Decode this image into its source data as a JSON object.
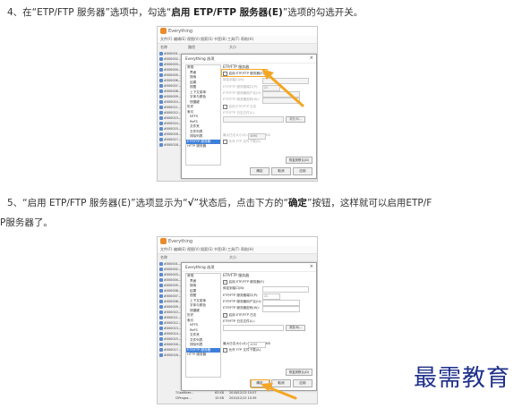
{
  "step4": {
    "pre": "4、在“ETP/FTP 服务器”选项中，勾选“",
    "bold": "启用 ETP/FTP 服务器(E)",
    "post": "”选项的勾选开关。"
  },
  "step5": {
    "line1_pre": "5、“启用 ETP/FTP 服务器(E)”选项显示为“",
    "line1_bold": "√",
    "line1_mid": "”状态后，点击下方的“",
    "line1_bold2": "确定",
    "line1_post": "”按钮，这样就可以启用ETP/F",
    "line2": "P服务器了。"
  },
  "app": {
    "title": "Everything",
    "menus": [
      "文件(F)",
      "编辑(E)",
      "视图(V)",
      "搜索(S)",
      "书签(B)",
      "工具(T)",
      "帮助(H)"
    ],
    "col_name": "名称",
    "col_path": "路径",
    "col_size": "大小",
    "col_modified": "修改时间"
  },
  "files": [
    "#000001...",
    "#000002...",
    "#000003...",
    "#000004...",
    "#000005...",
    "#000006...",
    "#000007...",
    "#000008...",
    "#000009...",
    "#000010...",
    "#000011...",
    "#000012...",
    "#000013...",
    "#000014...",
    "#000015...",
    "#000016...",
    "#000017...",
    "#000018..."
  ],
  "status_row": {
    "name": "TGsoftlcer...",
    "size": "63 KB",
    "date": "2018/12/13 10:57"
  },
  "status_row2": {
    "name": "CIProgra...",
    "size": "15 KB",
    "date": "2020/12/12 10:39"
  },
  "dialog": {
    "title": "Everything 选项",
    "close": "×",
    "pane_title": "ETP/FTP 服务器",
    "enable_label": "启用 ETP/FTP 服务器(E)",
    "bind_label": "绑定到接口(B):",
    "port_label": "ETP/FTP 服务器端口(P):",
    "port_value": "21",
    "user_label": "ETP/FTP 服务器用户名(U):",
    "pass_label": "ETP/FTP 服务器密码(W):",
    "log_label": "启用 ETP/FTP 日志",
    "log_file_label": "ETP/FTP 日志文件(L):",
    "browse": "浏览(B)...",
    "max_size_label": "最大日志大小(S):",
    "max_size_value": "4096",
    "kb": "KB",
    "allow_label": "允许 FTP 文件下载(A)",
    "restore": "恢复到默认(D)",
    "ok": "确定",
    "cancel": "取消",
    "apply": "应用",
    "check_mark": "✓"
  },
  "tree": [
    "常规",
    "界面",
    "搜索",
    "结果",
    "视图",
    "上下文菜单",
    "字体与颜色",
    "快捷键",
    "历史",
    "索引",
    "NTFS",
    "ReFS",
    "文件夹",
    "文件列表",
    "排除列表",
    "ETP/FTP 服务器",
    "HTTP 服务器"
  ],
  "watermark": "最需教育",
  "colors": {
    "highlight": "#f5a623",
    "selected": "#3d7fd9",
    "watermark": "#1d2f8a"
  }
}
